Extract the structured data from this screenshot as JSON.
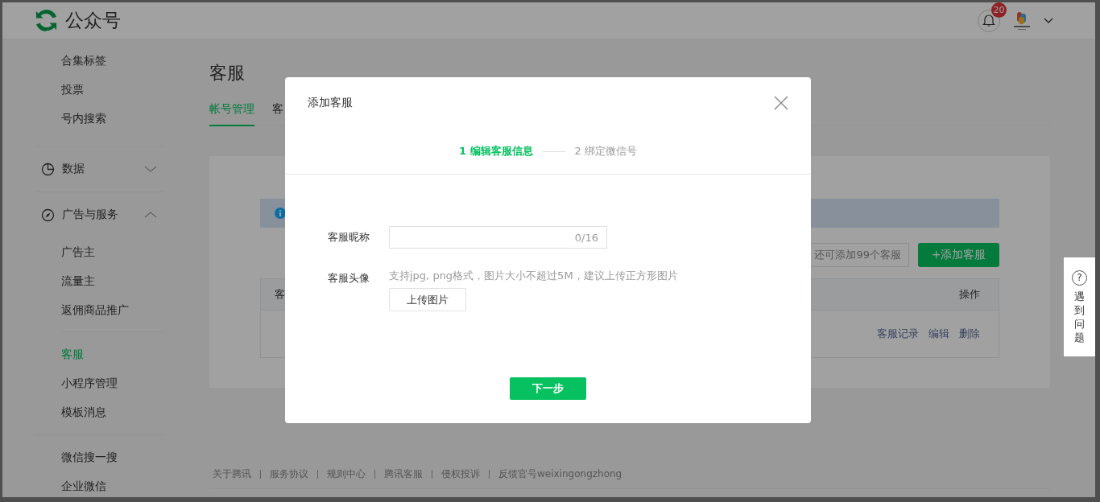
{
  "header": {
    "logo_text": "公众号",
    "notification_count": "20"
  },
  "sidebar": {
    "groups": [
      {
        "kind": "list",
        "items": [
          {
            "label": "合集标签",
            "selected": false
          },
          {
            "label": "投票",
            "selected": false
          },
          {
            "label": "号内搜索",
            "selected": false
          }
        ]
      },
      {
        "kind": "section",
        "title": "数据",
        "expanded": false
      },
      {
        "kind": "section",
        "title": "广告与服务",
        "expanded": true,
        "items": [
          {
            "label": "广告主",
            "selected": false
          },
          {
            "label": "流量主",
            "selected": false
          },
          {
            "label": "返佣商品推广",
            "selected": false
          }
        ]
      },
      {
        "kind": "list",
        "items": [
          {
            "label": "客服",
            "selected": true
          },
          {
            "label": "小程序管理",
            "selected": false
          },
          {
            "label": "模板消息",
            "selected": false
          }
        ]
      },
      {
        "kind": "list",
        "items": [
          {
            "label": "微信搜一搜",
            "selected": false
          },
          {
            "label": "企业微信",
            "selected": false
          }
        ]
      }
    ]
  },
  "main": {
    "title": "客服",
    "tabs": [
      {
        "label": "帐号管理",
        "selected": true
      },
      {
        "label": "客",
        "selected": false
      }
    ],
    "quota_tip": "还可添加99个客服",
    "add_button": "+添加客服",
    "table": {
      "columns": [
        "客",
        "操作"
      ],
      "rows": [
        {
          "actions": [
            "客服记录",
            "编辑",
            "删除"
          ]
        }
      ]
    },
    "footer_links": [
      "关于腾讯",
      "服务协议",
      "规则中心",
      "腾讯客服",
      "侵权投诉",
      "反馈官号weixingongzhong"
    ]
  },
  "dialog": {
    "title": "添加客服",
    "steps": [
      {
        "label": "1 编辑客服信息",
        "selected": true
      },
      {
        "label": "2 绑定微信号",
        "selected": false
      }
    ],
    "fields": [
      {
        "kind": "text",
        "label": "客服昵称",
        "counter": "0/16"
      },
      {
        "kind": "upload",
        "label": "客服头像",
        "hint": "支持jpg, png格式，图片大小不超过5M，建议上传正方形图片",
        "button": "上传图片"
      }
    ],
    "next_button": "下一步"
  },
  "help": {
    "icon": "?",
    "label": "遇到问题"
  }
}
